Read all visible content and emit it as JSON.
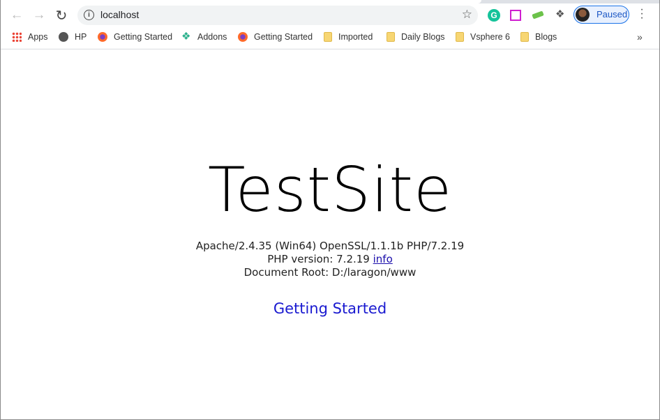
{
  "browser": {
    "url": "localhost",
    "profile_label": "Paused",
    "extensions": [
      "grammarly-icon",
      "screen-recorder-icon",
      "green-extension-icon",
      "puzzle-extensions-icon"
    ],
    "bookmarks": [
      {
        "label": "Apps",
        "icon": "apps-grid-icon"
      },
      {
        "label": "HP",
        "icon": "globe-icon"
      },
      {
        "label": "Getting Started",
        "icon": "firefox-icon"
      },
      {
        "label": "Addons",
        "icon": "puzzle-icon"
      },
      {
        "label": "Getting Started",
        "icon": "firefox-icon"
      },
      {
        "label": "Imported",
        "icon": "folder-icon"
      },
      {
        "label": "Daily Blogs",
        "icon": "folder-icon"
      },
      {
        "label": "Vsphere 6",
        "icon": "folder-icon"
      },
      {
        "label": "Blogs",
        "icon": "folder-icon"
      }
    ],
    "more_label": "»"
  },
  "page": {
    "title": "TestSite",
    "server_line": "Apache/2.4.35 (Win64) OpenSSL/1.1.1b PHP/7.2.19",
    "php_version_label": "PHP version: 7.2.19",
    "info_link": "info",
    "doc_root": "Document Root: D:/laragon/www",
    "getting_started_link": "Getting Started"
  },
  "colors": {
    "link": "#1a1ad0",
    "profile": "#1a73e8"
  }
}
